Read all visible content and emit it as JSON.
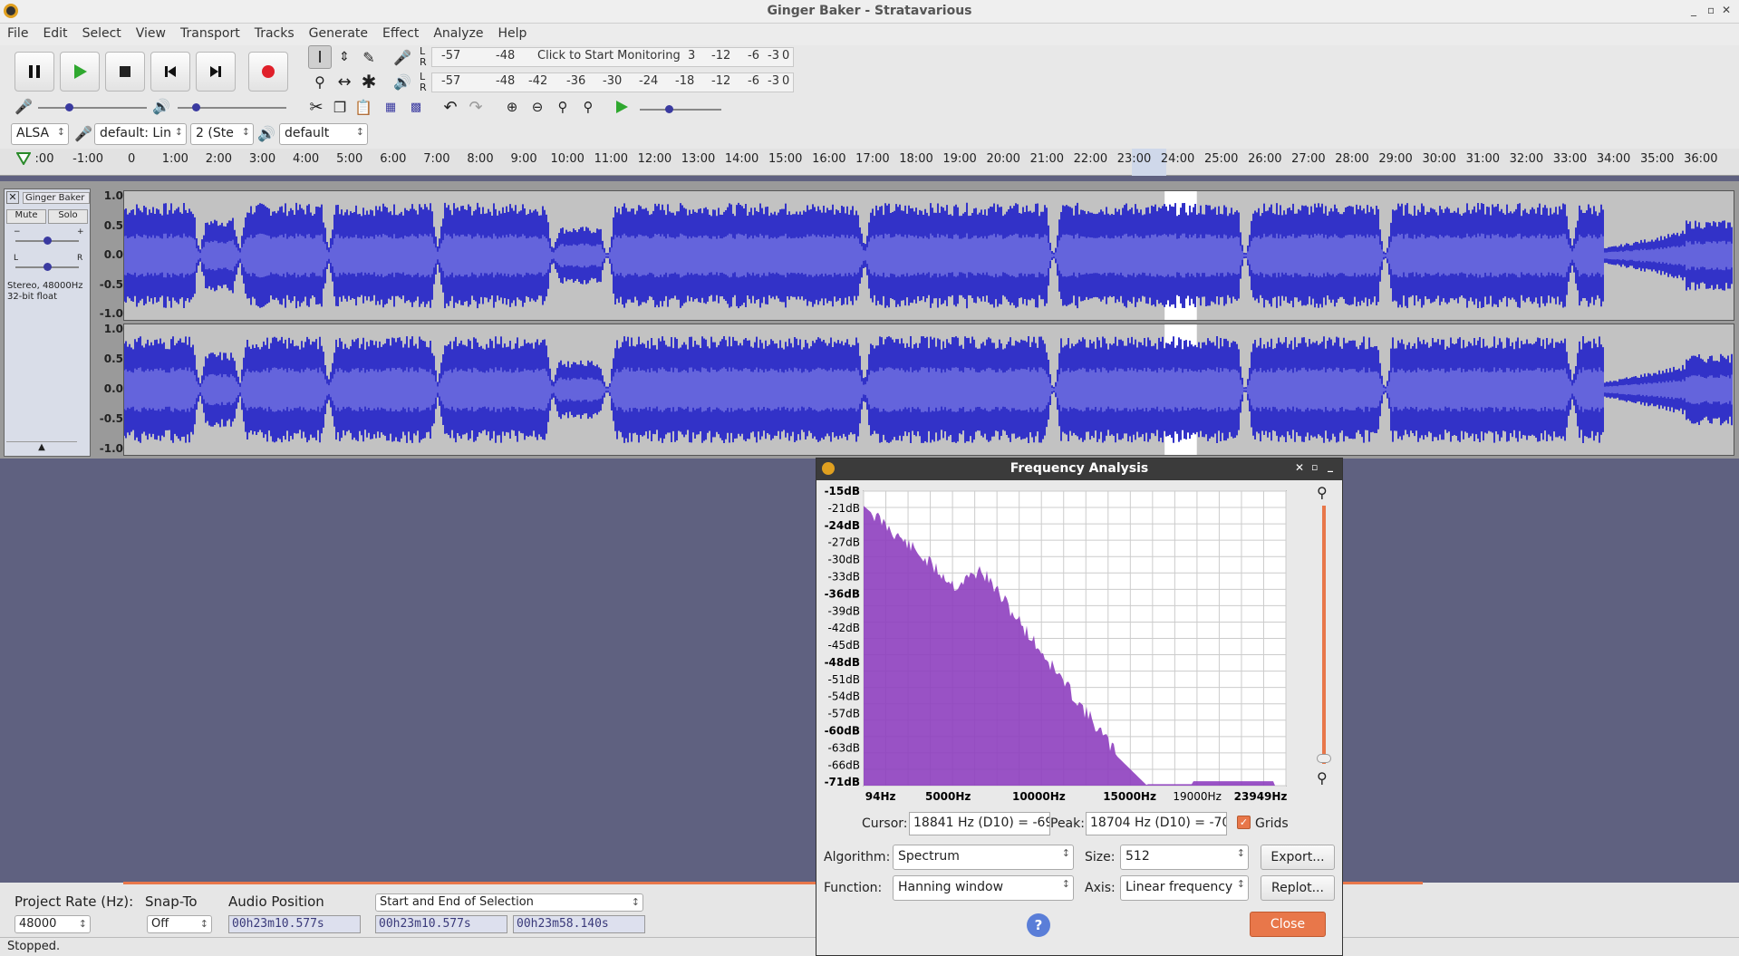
{
  "window": {
    "title": "Ginger Baker - Stratavarious"
  },
  "menu": [
    "File",
    "Edit",
    "Select",
    "View",
    "Transport",
    "Tracks",
    "Generate",
    "Effect",
    "Analyze",
    "Help"
  ],
  "meters": {
    "record_scale": [
      "-57",
      "-48",
      "Click to Start Monitoring",
      "3",
      "-12",
      "-6",
      "-3",
      "0"
    ],
    "play_scale": [
      "-57",
      "-48",
      "-42",
      "-36",
      "-30",
      "-24",
      "-18",
      "-12",
      "-6",
      "-3",
      "0"
    ],
    "channel_l": "L",
    "channel_r": "R"
  },
  "device": {
    "host": "ALSA",
    "recording": "default: Lin",
    "channels": "2 (Ste",
    "playback": "default"
  },
  "ruler": {
    "ticks": [
      ":00",
      "-1:00",
      "0",
      "1:00",
      "2:00",
      "3:00",
      "4:00",
      "5:00",
      "6:00",
      "7:00",
      "8:00",
      "9:00",
      "10:00",
      "11:00",
      "12:00",
      "13:00",
      "14:00",
      "15:00",
      "16:00",
      "17:00",
      "18:00",
      "19:00",
      "20:00",
      "21:00",
      "22:00",
      "23:00",
      "24:00",
      "25:00",
      "26:00",
      "27:00",
      "28:00",
      "29:00",
      "30:00",
      "31:00",
      "32:00",
      "33:00",
      "34:00",
      "35:00",
      "36:00"
    ]
  },
  "track": {
    "name": "Ginger Baker",
    "mute": "Mute",
    "solo": "Solo",
    "gain_minus": "−",
    "gain_plus": "+",
    "pan_l": "L",
    "pan_r": "R",
    "info": "Stereo, 48000Hz",
    "format": "32-bit float",
    "scale": [
      "1.0",
      "0.5",
      "0.0",
      "-0.5",
      "-1.0"
    ],
    "selection_fraction": {
      "start": 0.6465,
      "end": 0.6665
    }
  },
  "bottom": {
    "rate_label": "Project Rate (Hz):",
    "rate_value": "48000",
    "snap_label": "Snap-To",
    "snap_value": "Off",
    "position_label": "Audio Position",
    "selection_mode": "Start and End of Selection",
    "audio_position": "00h23m10.577s",
    "selection_start": "00h23m10.577s",
    "selection_end": "00h23m58.140s",
    "status": "Stopped."
  },
  "dialog": {
    "title": "Frequency Analysis",
    "db_labels": [
      "-15dB",
      "-21dB",
      "-24dB",
      "-27dB",
      "-30dB",
      "-33dB",
      "-36dB",
      "-39dB",
      "-42dB",
      "-45dB",
      "-48dB",
      "-51dB",
      "-54dB",
      "-57dB",
      "-60dB",
      "-63dB",
      "-66dB",
      "-71dB"
    ],
    "freq_labels": [
      "94Hz",
      "5000Hz",
      "10000Hz",
      "15000Hz",
      "19000Hz",
      "23949Hz"
    ],
    "cursor_label": "Cursor:",
    "cursor_value": "18841 Hz (D10) = -69",
    "peak_label": "Peak:",
    "peak_value": "18704 Hz (D10) = -70",
    "grids_label": "Grids",
    "algorithm_label": "Algorithm:",
    "algorithm_value": "Spectrum",
    "size_label": "Size:",
    "size_value": "512",
    "export_label": "Export...",
    "function_label": "Function:",
    "function_value": "Hanning window",
    "axis_label": "Axis:",
    "axis_value": "Linear frequency",
    "replot_label": "Replot...",
    "help_label": "?",
    "close_label": "Close",
    "spectrum_color": "#8e3fbf"
  }
}
